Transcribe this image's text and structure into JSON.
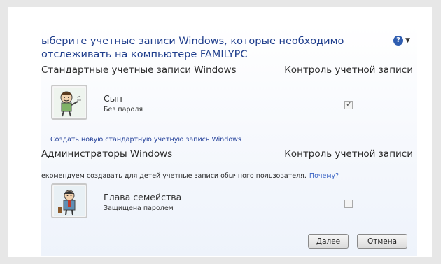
{
  "dialog": {
    "heading_line1": "ыберите учетные записи Windows, которые необходимо",
    "heading_line2": "отслеживать на компьютере FAMILYPC",
    "help_icon": "help-icon"
  },
  "standard_section": {
    "title": "Стандартные учетные записи Windows",
    "column_label": "Контроль учетной записи"
  },
  "standard_accounts": [
    {
      "name": "Сын",
      "subtitle": "Без пароля",
      "monitored": true
    }
  ],
  "create_link": "Создать новую стандартную учетную запись Windows",
  "admin_section": {
    "title": "Администраторы Windows",
    "column_label": "Контроль учетной записи"
  },
  "recommendation": {
    "text": "екомендуем создавать для детей учетные записи обычного пользователя.",
    "link": "Почему?"
  },
  "admin_accounts": [
    {
      "name": "Глава семейства",
      "subtitle": "Защищена паролем",
      "monitored": false
    }
  ],
  "buttons": {
    "next": "Далее",
    "cancel": "Отмена"
  }
}
